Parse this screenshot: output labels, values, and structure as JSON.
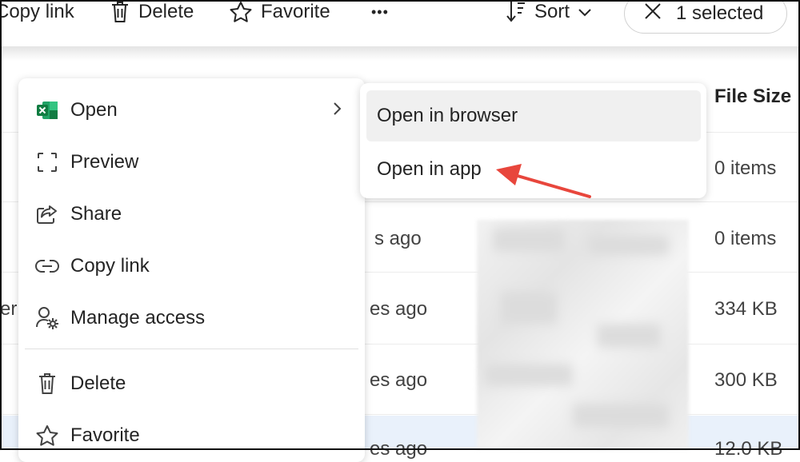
{
  "toolbar": {
    "copy_link": "Copy link",
    "delete": "Delete",
    "favorite": "Favorite",
    "more": "•••",
    "sort": "Sort",
    "selected": "1 selected"
  },
  "list": {
    "file_size_header": "File Size",
    "rows": [
      {
        "modified": "",
        "size": "0 items"
      },
      {
        "modified": "s ago",
        "size": "0 items"
      },
      {
        "modified": "es ago",
        "size": "334 KB",
        "name_fragment": "er"
      },
      {
        "modified": "es ago",
        "size": "300 KB"
      },
      {
        "modified": "es ago",
        "size": "12.0 KB",
        "name_fragment": ""
      }
    ]
  },
  "context_menu": {
    "items": [
      {
        "label": "Open",
        "icon": "excel-icon"
      },
      {
        "label": "Preview",
        "icon": "preview-icon"
      },
      {
        "label": "Share",
        "icon": "share-icon"
      },
      {
        "label": "Copy link",
        "icon": "link-icon"
      },
      {
        "label": "Manage access",
        "icon": "manage-access-icon"
      },
      {
        "label": "Delete",
        "icon": "trash-icon"
      },
      {
        "label": "Favorite",
        "icon": "star-icon"
      }
    ]
  },
  "submenu": {
    "items": [
      {
        "label": "Open in browser"
      },
      {
        "label": "Open in app"
      }
    ]
  },
  "colors": {
    "excel_green": "#107c41",
    "annotation_red": "#e8463c",
    "selected_row": "#e9f1fb"
  }
}
